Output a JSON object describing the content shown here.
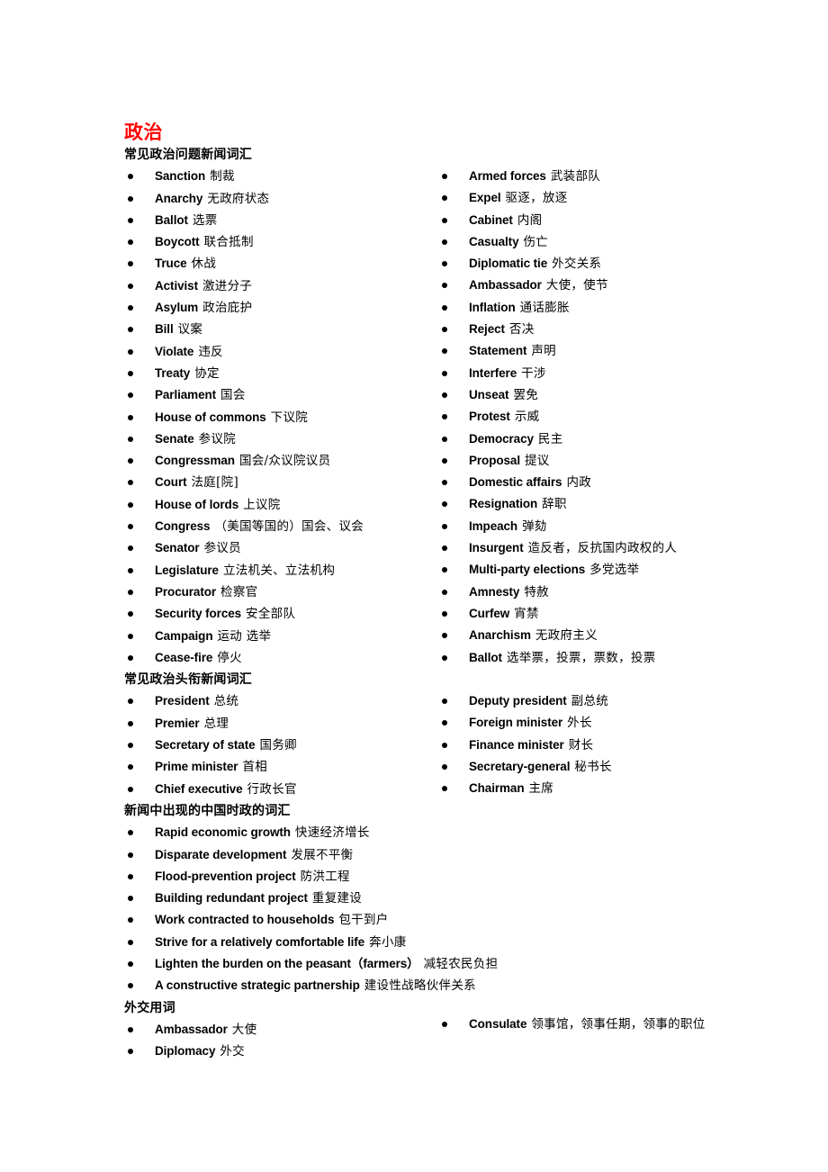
{
  "document": {
    "title": "政治",
    "title_color": "#FF0000",
    "background_color": "#FFFFFF",
    "text_color": "#000000"
  },
  "left_column": [
    {
      "type": "heading",
      "text": "常见政治问题新闻词汇"
    },
    {
      "type": "item",
      "en": "Sanction",
      "zh": "制裁"
    },
    {
      "type": "item",
      "en": "Anarchy",
      "zh": "无政府状态"
    },
    {
      "type": "item",
      "en": "Ballot",
      "zh": "选票"
    },
    {
      "type": "item",
      "en": "Boycott",
      "zh": "联合抵制"
    },
    {
      "type": "item",
      "en": "Truce",
      "zh": "休战"
    },
    {
      "type": "item",
      "en": "Activist",
      "zh": "激进分子"
    },
    {
      "type": "item",
      "en": "Asylum",
      "zh": "政治庇护"
    },
    {
      "type": "item",
      "en": "Bill",
      "zh": "议案"
    },
    {
      "type": "item",
      "en": "Violate",
      "zh": "违反"
    },
    {
      "type": "item",
      "en": "Treaty",
      "zh": "协定"
    },
    {
      "type": "item",
      "en": "Parliament",
      "zh": "国会"
    },
    {
      "type": "item",
      "en": "House of commons",
      "zh": "下议院"
    },
    {
      "type": "item",
      "en": "Senate",
      "zh": "参议院"
    },
    {
      "type": "item",
      "en": "Congressman",
      "zh": "国会/众议院议员"
    },
    {
      "type": "item",
      "en": "Court",
      "zh": "法庭[院]"
    },
    {
      "type": "item",
      "en": "House of lords",
      "zh": "上议院"
    },
    {
      "type": "item",
      "en": "Congress",
      "zh": "（美国等国的）国会、议会"
    },
    {
      "type": "item",
      "en": "Senator",
      "zh": "参议员"
    },
    {
      "type": "item",
      "en": "Legislature",
      "zh": "立法机关、立法机构"
    },
    {
      "type": "item",
      "en": "Procurator",
      "zh": "检察官"
    },
    {
      "type": "item",
      "en": "Security forces",
      "zh": "安全部队"
    },
    {
      "type": "item",
      "en": "Campaign",
      "zh": "运动 选举"
    },
    {
      "type": "item",
      "en": "Cease-fire",
      "zh": "停火"
    },
    {
      "type": "heading",
      "text": "常见政治头衔新闻词汇"
    },
    {
      "type": "item",
      "en": "President",
      "zh": "总统"
    },
    {
      "type": "item",
      "en": "Premier",
      "zh": "总理"
    },
    {
      "type": "item",
      "en": "Secretary of state",
      "zh": "国务卿"
    },
    {
      "type": "item",
      "en": "Prime minister",
      "zh": "首相"
    },
    {
      "type": "item",
      "en": "Chief executive",
      "zh": "行政长官"
    },
    {
      "type": "heading",
      "text": "新闻中出现的中国时政的词汇"
    },
    {
      "type": "item",
      "en": "Rapid economic growth",
      "zh": "快速经济增长"
    },
    {
      "type": "item",
      "en": "Disparate development",
      "zh": "发展不平衡"
    },
    {
      "type": "item",
      "en": "Flood-prevention project",
      "zh": "防洪工程"
    },
    {
      "type": "item",
      "en": "Building redundant project",
      "zh": "重复建设"
    },
    {
      "type": "item",
      "en": "Work contracted to households",
      "zh": "包干到户"
    },
    {
      "type": "item",
      "en": "Strive for a relatively comfortable life",
      "zh": "奔小康"
    },
    {
      "type": "item",
      "en": "Lighten the burden on the peasant（farmers）",
      "zh": "减轻农民负担"
    },
    {
      "type": "item",
      "en": "A constructive strategic partnership",
      "zh": "建设性战略伙伴关系"
    },
    {
      "type": "heading",
      "text": "外交用词"
    },
    {
      "type": "item",
      "en": "Ambassador",
      "zh": "大使"
    },
    {
      "type": "item",
      "en": "Diplomacy",
      "zh": "外交"
    }
  ],
  "right_column": [
    {
      "type": "item",
      "en": "Armed forces",
      "zh": "武装部队"
    },
    {
      "type": "item",
      "en": "Expel",
      "zh": "驱逐，放逐"
    },
    {
      "type": "item",
      "en": "Cabinet",
      "zh": "内阁"
    },
    {
      "type": "item",
      "en": "Casualty",
      "zh": "伤亡"
    },
    {
      "type": "item",
      "en": "Diplomatic tie",
      "zh": "外交关系"
    },
    {
      "type": "item",
      "en": "Ambassador",
      "zh": "大使，使节"
    },
    {
      "type": "item",
      "en": "Inflation",
      "zh": "通话膨胀"
    },
    {
      "type": "item",
      "en": "Reject",
      "zh": "否决"
    },
    {
      "type": "item",
      "en": "Statement",
      "zh": "声明"
    },
    {
      "type": "item",
      "en": "Interfere",
      "zh": "干涉"
    },
    {
      "type": "item",
      "en": "Unseat",
      "zh": "罢免"
    },
    {
      "type": "item",
      "en": "Protest",
      "zh": "示威"
    },
    {
      "type": "item",
      "en": "Democracy",
      "zh": "民主"
    },
    {
      "type": "item",
      "en": "Proposal",
      "zh": "提议"
    },
    {
      "type": "item",
      "en": "Domestic affairs",
      "zh": "内政"
    },
    {
      "type": "item",
      "en": "Resignation",
      "zh": "辞职"
    },
    {
      "type": "item",
      "en": "Impeach",
      "zh": "弹劾"
    },
    {
      "type": "item",
      "en": "Insurgent",
      "zh": "造反者，反抗国内政权的人"
    },
    {
      "type": "item",
      "en": "Multi-party elections",
      "zh": "多党选举"
    },
    {
      "type": "item",
      "en": "Amnesty",
      "zh": "特赦"
    },
    {
      "type": "item",
      "en": "Curfew",
      "zh": "宵禁"
    },
    {
      "type": "item",
      "en": "Anarchism",
      "zh": "无政府主义"
    },
    {
      "type": "item",
      "en": "Ballot",
      "zh": "选举票，投票，票数，投票"
    },
    {
      "type": "spacer"
    },
    {
      "type": "item",
      "en": "Deputy president",
      "zh": "副总统"
    },
    {
      "type": "item",
      "en": "Foreign minister",
      "zh": "外长"
    },
    {
      "type": "item",
      "en": "Finance minister",
      "zh": "财长"
    },
    {
      "type": "item",
      "en": "Secretary-general",
      "zh": "秘书长"
    },
    {
      "type": "item",
      "en": "Chairman",
      "zh": "主席"
    }
  ],
  "right_column_tail": [
    {
      "type": "item",
      "en": "Consulate",
      "zh": "领事馆，领事任期，领事的职位",
      "wrap": true
    }
  ]
}
